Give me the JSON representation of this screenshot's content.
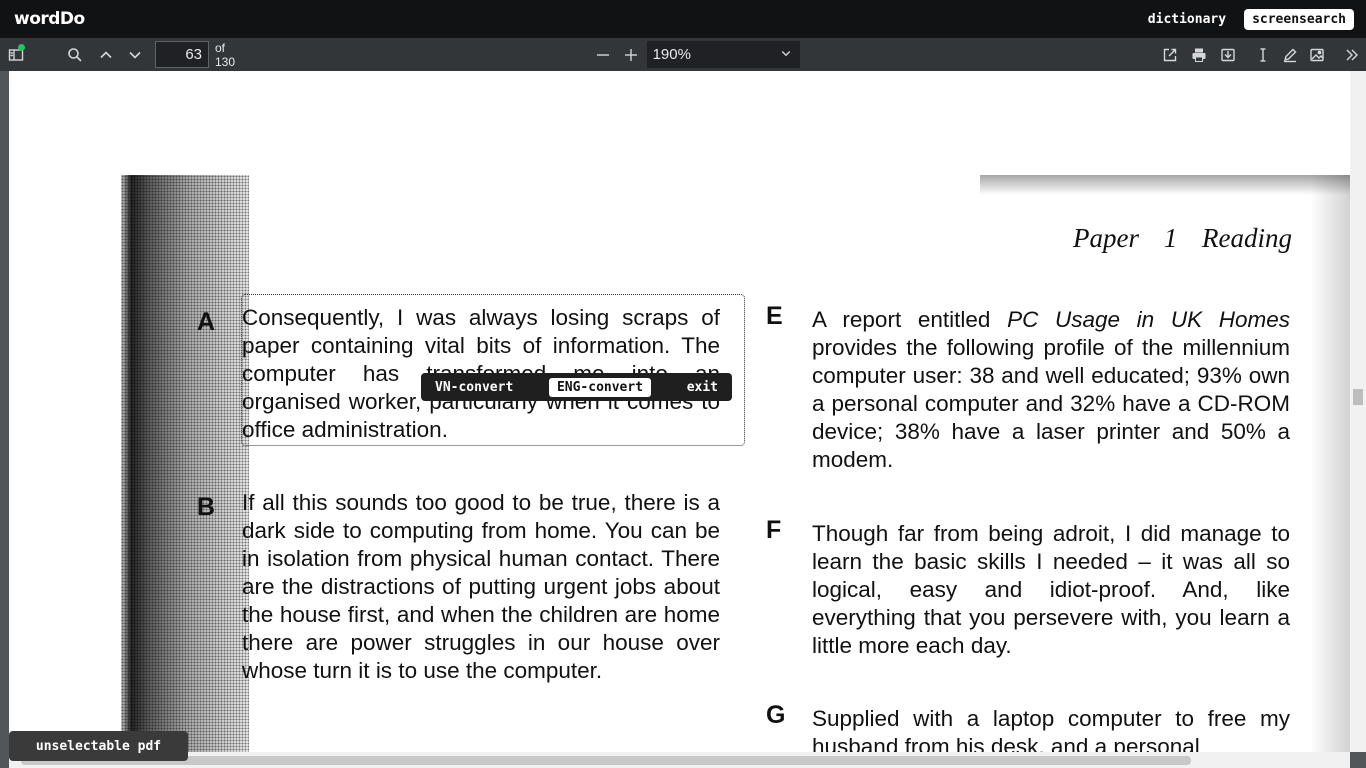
{
  "app": {
    "logo": "wordDo",
    "dictionary_label": "dictionary",
    "screensearch_label": "screensearch"
  },
  "toolbar": {
    "page_current": "63",
    "page_total": "of 130",
    "zoom": "190%"
  },
  "document": {
    "header": "Paper 1   Reading",
    "sections": [
      {
        "letter": "A",
        "text": "Consequently, I was always losing scraps of paper containing vital bits of information. The computer has transformed me into an organised worker, particularly when it comes to office administration."
      },
      {
        "letter": "B",
        "text": "If all this sounds too good to be true, there is a dark side to computing from home. You can be in isolation from physical human contact. There are the distractions of putting urgent jobs about the house first, and when the children are home there are power struggles in our house over whose turn it is to use the computer."
      },
      {
        "letter": "E",
        "text_before": "A report entitled ",
        "text_italic": "PC Usage in UK Homes",
        "text_after": " provides the following profile of the millennium computer user: 38 and well educated; 93% own a personal computer and 32% have a CD-ROM device; 38% have a laser printer and 50% a modem."
      },
      {
        "letter": "F",
        "text": "Though far from being adroit, I did manage to learn the basic skills I needed – it was all so logical, easy and idiot-proof. And, like everything that you persevere with, you learn a little more each day."
      },
      {
        "letter": "G",
        "text": "Supplied with a laptop computer to free my husband from his desk, and a personal"
      }
    ]
  },
  "convert_bar": {
    "vn": "VN-convert",
    "eng": "ENG-convert",
    "exit": "exit"
  },
  "status_badge": "unselectable pdf"
}
